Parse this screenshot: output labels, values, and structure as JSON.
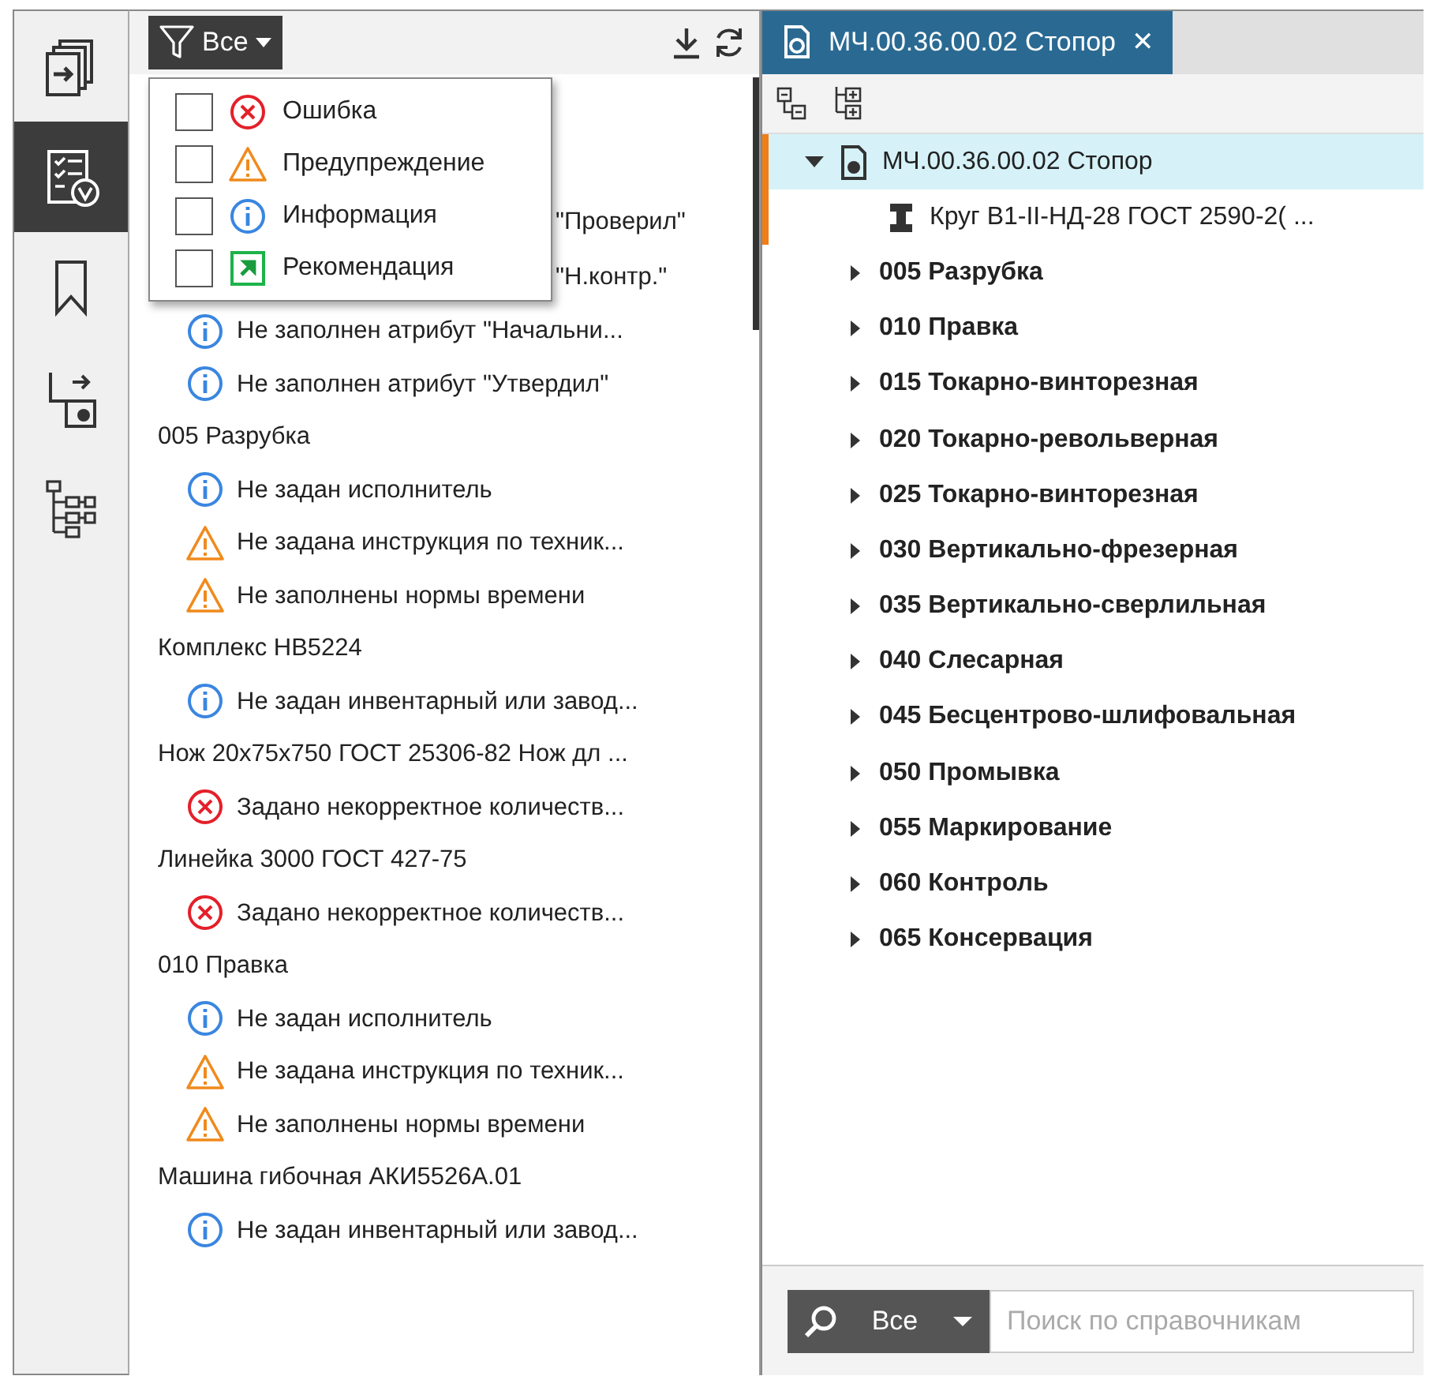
{
  "sidebar": {
    "items": [
      {
        "selected": false
      },
      {
        "selected": true
      },
      {
        "selected": false
      },
      {
        "selected": false
      },
      {
        "selected": false
      }
    ]
  },
  "filter": {
    "label": "Все",
    "menu": [
      {
        "kind": "error",
        "label": "Ошибка",
        "checked": false
      },
      {
        "kind": "warning",
        "label": "Предупреждение",
        "checked": false
      },
      {
        "kind": "info",
        "label": "Информация",
        "checked": false
      },
      {
        "kind": "recommendation",
        "label": "Рекомендация",
        "checked": false
      }
    ]
  },
  "messages": [
    {
      "kind": "partial",
      "text": "\"Проверил\""
    },
    {
      "kind": "partial",
      "text": "\"Н.контр.\""
    },
    {
      "kind": "info",
      "text": "Не заполнен атрибут \"Начальни..."
    },
    {
      "kind": "info",
      "text": "Не заполнен атрибут \"Утвердил\""
    },
    {
      "kind": "header",
      "text": "005 Разрубка"
    },
    {
      "kind": "info",
      "text": "Не задан исполнитель"
    },
    {
      "kind": "warning",
      "text": "Не задана инструкция по техник..."
    },
    {
      "kind": "warning",
      "text": "Не заполнены нормы времени"
    },
    {
      "kind": "header",
      "text": "Комплекс НВ5224"
    },
    {
      "kind": "info",
      "text": "Не задан инвентарный или завод..."
    },
    {
      "kind": "header",
      "text": "Нож 20х75х750 ГОСТ 25306-82 Нож дл ..."
    },
    {
      "kind": "error",
      "text": "Задано некорректное количеств..."
    },
    {
      "kind": "header",
      "text": "Линейка 3000 ГОСТ 427-75"
    },
    {
      "kind": "error",
      "text": "Задано некорректное количеств..."
    },
    {
      "kind": "header",
      "text": "010 Правка"
    },
    {
      "kind": "info",
      "text": "Не задан исполнитель"
    },
    {
      "kind": "warning",
      "text": "Не задана инструкция по техник..."
    },
    {
      "kind": "warning",
      "text": "Не заполнены нормы времени"
    },
    {
      "kind": "header",
      "text": "Машина гибочная АКИ5526А.01"
    },
    {
      "kind": "info",
      "text": "Не задан инвентарный или завод..."
    }
  ],
  "tab": {
    "title": "МЧ.00.36.00.02 Стопор",
    "close": "✕",
    "selected": true
  },
  "tree": {
    "label": "МЧ.00.36.00.02 Стопор",
    "expanded": true,
    "selected": true,
    "children": [
      {
        "kind": "material",
        "label": "Круг В1-II-НД-28 ГОСТ 2590-2( ..."
      },
      {
        "kind": "operation",
        "label": "005 Разрубка",
        "expanded": false
      },
      {
        "kind": "operation",
        "label": "010 Правка",
        "expanded": false
      },
      {
        "kind": "operation",
        "label": "015 Токарно-винторезная",
        "expanded": false
      },
      {
        "kind": "operation",
        "label": "020 Токарно-револьверная",
        "expanded": false
      },
      {
        "kind": "operation",
        "label": "025 Токарно-винторезная",
        "expanded": false
      },
      {
        "kind": "operation",
        "label": "030 Вертикально-фрезерная",
        "expanded": false
      },
      {
        "kind": "operation",
        "label": "035 Вертикально-сверлильная",
        "expanded": false
      },
      {
        "kind": "operation",
        "label": "040 Слесарная",
        "expanded": false
      },
      {
        "kind": "operation",
        "label": "045 Бесцентрово-шлифовальная",
        "expanded": false
      },
      {
        "kind": "operation",
        "label": "050 Промывка",
        "expanded": false
      },
      {
        "kind": "operation",
        "label": "055 Маркирование",
        "expanded": false
      },
      {
        "kind": "operation",
        "label": "060 Контроль",
        "expanded": false
      },
      {
        "kind": "operation",
        "label": "065 Консервация",
        "expanded": false
      }
    ]
  },
  "search": {
    "scope": "Все",
    "placeholder": "Поиск по справочникам"
  }
}
